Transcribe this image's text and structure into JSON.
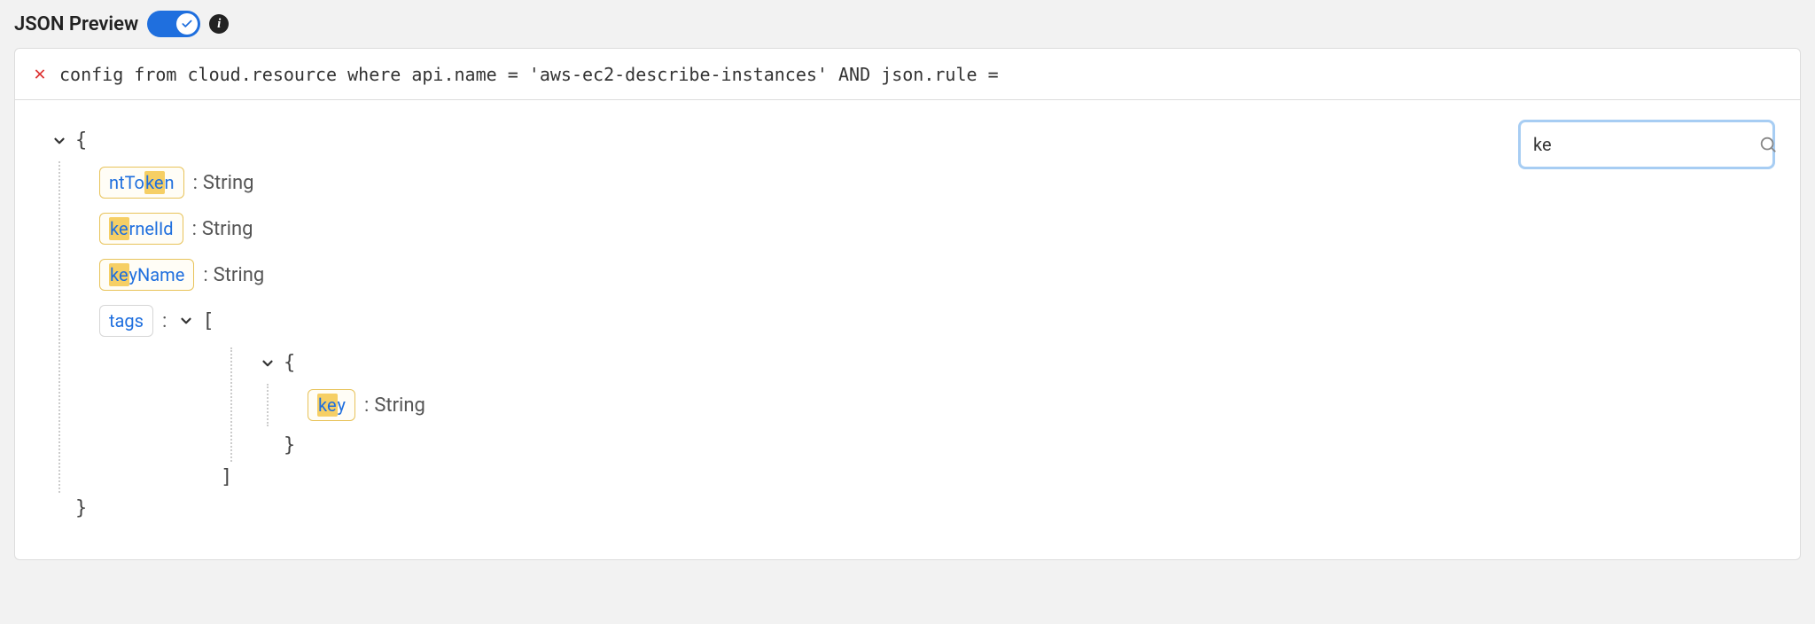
{
  "header": {
    "title": "JSON Preview",
    "toggle_on": true,
    "info_tooltip_glyph": "i"
  },
  "query_bar": {
    "clear_glyph": "✕",
    "text": "config from cloud.resource where api.name = 'aws-ec2-describe-instances' AND json.rule ="
  },
  "search": {
    "value": "ke",
    "placeholder": ""
  },
  "tree": {
    "open_brace": "{",
    "close_brace": "}",
    "array_open": "[",
    "array_close": "]",
    "props": [
      {
        "key_pre": "ntTo",
        "key_hl": "ke",
        "key_post": "n",
        "type": "String",
        "highlight": true
      },
      {
        "key_pre": "",
        "key_hl": "ke",
        "key_post": "rnelId",
        "type": "String",
        "highlight": true
      },
      {
        "key_pre": "",
        "key_hl": "ke",
        "key_post": "yName",
        "type": "String",
        "highlight": true
      }
    ],
    "tags": {
      "label": "tags",
      "highlight": false,
      "inner": {
        "key_pre": "",
        "key_hl": "ke",
        "key_post": "y",
        "type": "String",
        "highlight": true
      }
    }
  }
}
